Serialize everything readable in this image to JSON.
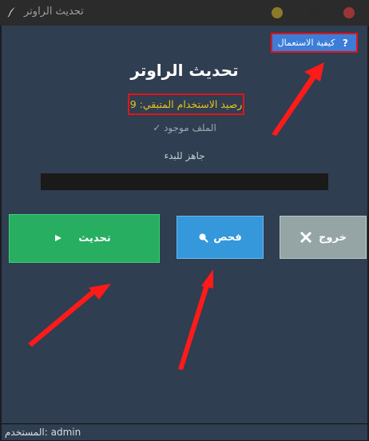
{
  "window": {
    "title": "تحديث الراوتر",
    "app_icon": "feather-icon",
    "buttons": [
      "minimize",
      "maximize",
      "close"
    ]
  },
  "help": {
    "label": "كيفية الاستعمال",
    "icon": "question-icon"
  },
  "main": {
    "title": "تحديث الراوتر",
    "balance_label": "رصيد الاستخدام المتبقي: 9",
    "file_status": "الملف موجود ✓",
    "ready_text": "جاهز للبدء",
    "progress": 0
  },
  "buttons": {
    "update_label": "تحديث",
    "update_icon": "play-icon",
    "check_label": "فحص",
    "check_icon": "search-icon",
    "exit_label": "خروج",
    "exit_icon": "close-icon"
  },
  "status_bar": {
    "text": "المستخدم: admin"
  },
  "colors": {
    "background": "#2f3e50",
    "update": "#27ae60",
    "check": "#3498db",
    "exit": "#95a5a6",
    "balance_text": "#e8c21c",
    "highlight": "#e0141a"
  }
}
